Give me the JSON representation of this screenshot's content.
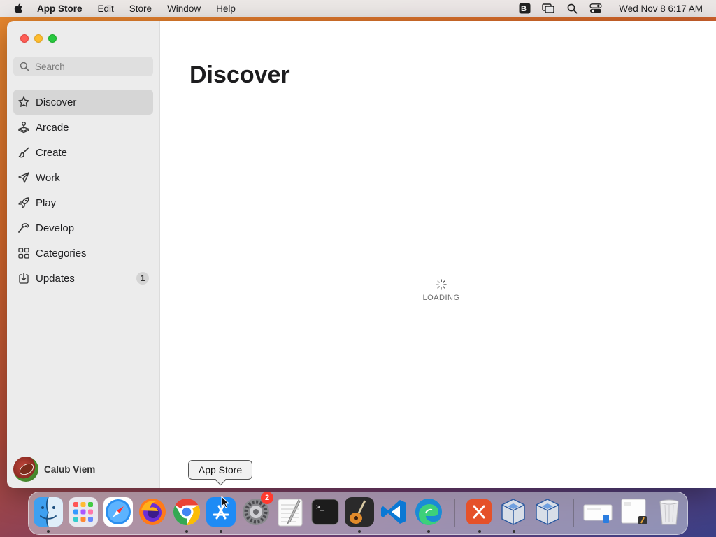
{
  "menubar": {
    "apple_icon": "apple-logo-icon",
    "app_name": "App Store",
    "menus": [
      "Edit",
      "Store",
      "Window",
      "Help"
    ],
    "status_icons": [
      "bbedit-status-icon",
      "screen-mirroring-icon",
      "spotlight-search-icon",
      "control-center-icon"
    ],
    "clock": "Wed Nov 8  6:17 AM"
  },
  "window": {
    "traffic_lights": [
      "close",
      "minimize",
      "zoom"
    ]
  },
  "sidebar": {
    "search": {
      "placeholder": "Search",
      "value": ""
    },
    "items": [
      {
        "label": "Discover",
        "icon": "star-icon",
        "selected": true
      },
      {
        "label": "Arcade",
        "icon": "joystick-icon"
      },
      {
        "label": "Create",
        "icon": "paintbrush-icon"
      },
      {
        "label": "Work",
        "icon": "paperplane-icon"
      },
      {
        "label": "Play",
        "icon": "rocket-icon"
      },
      {
        "label": "Develop",
        "icon": "hammer-icon"
      },
      {
        "label": "Categories",
        "icon": "grid-icon"
      },
      {
        "label": "Updates",
        "icon": "download-icon",
        "badge": "1"
      }
    ],
    "account": {
      "name": "Calub Viem"
    }
  },
  "main": {
    "title": "Discover",
    "loading_text": "LOADING"
  },
  "tooltip": {
    "text": "App Store"
  },
  "dock": {
    "apps": [
      {
        "name": "Finder",
        "running": true
      },
      {
        "name": "Launchpad",
        "running": false
      },
      {
        "name": "Safari",
        "running": false
      },
      {
        "name": "Firefox",
        "running": false
      },
      {
        "name": "Google Chrome",
        "running": true
      },
      {
        "name": "App Store",
        "running": true
      },
      {
        "name": "System Settings",
        "running": false,
        "badge": "2"
      },
      {
        "name": "TextEdit",
        "running": false
      },
      {
        "name": "Terminal",
        "running": false
      },
      {
        "name": "GarageBand",
        "running": true
      },
      {
        "name": "Visual Studio Code",
        "running": false
      },
      {
        "name": "Microsoft Edge",
        "running": true
      },
      {
        "name": "Microsoft Remote Desktop",
        "running": true
      },
      {
        "name": "VirtualBox",
        "running": true
      },
      {
        "name": "VirtualBox VM",
        "running": false
      },
      {
        "name": "Downloads Stack",
        "running": false
      },
      {
        "name": "Documents Stack",
        "running": false
      },
      {
        "name": "Trash",
        "running": false
      }
    ]
  }
}
